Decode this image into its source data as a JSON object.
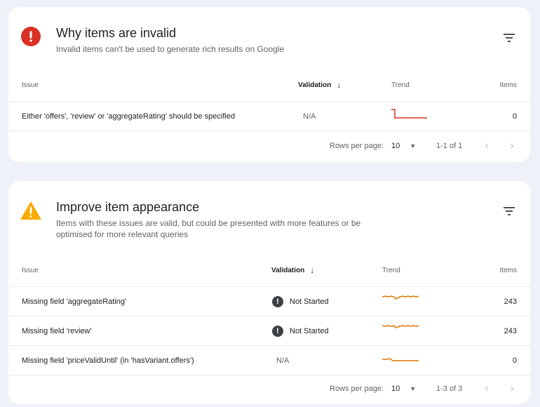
{
  "invalid_card": {
    "title": "Why items are invalid",
    "subtitle": "Invalid items can't be used to generate rich results on Google",
    "icon": "error-icon",
    "icon_color": "#d93025",
    "columns": {
      "issue": "Issue",
      "validation": "Validation",
      "trend": "Trend",
      "items": "Items"
    },
    "rows": [
      {
        "issue": "Either 'offers', 'review' or 'aggregateRating' should be specified",
        "validation": "N/A",
        "items": "0",
        "trend_color": "#d93025",
        "trend_shape": "drop"
      }
    ],
    "pager": {
      "rows_per_page_label": "Rows per page:",
      "rows_per_page": "10",
      "range": "1-1 of 1"
    }
  },
  "improve_card": {
    "title": "Improve item appearance",
    "subtitle": "Items with these issues are valid, but could be presented with more features or be optimised for more relevant queries",
    "icon": "warning-icon",
    "icon_color": "#f9ab00",
    "columns": {
      "issue": "Issue",
      "validation": "Validation",
      "trend": "Trend",
      "items": "Items"
    },
    "rows": [
      {
        "issue": "Missing field 'aggregateRating'",
        "validation": "Not Started",
        "items": "243",
        "trend_color": "#e37400",
        "trend_shape": "wavy"
      },
      {
        "issue": "Missing field 'review'",
        "validation": "Not Started",
        "items": "243",
        "trend_color": "#e37400",
        "trend_shape": "wavy"
      },
      {
        "issue": "Missing field 'priceValidUntil' (in 'hasVariant.offers')",
        "validation": "N/A",
        "items": "0",
        "trend_color": "#e37400",
        "trend_shape": "step"
      }
    ],
    "pager": {
      "rows_per_page_label": "Rows per page:",
      "rows_per_page": "10",
      "range": "1-3 of 3"
    }
  }
}
